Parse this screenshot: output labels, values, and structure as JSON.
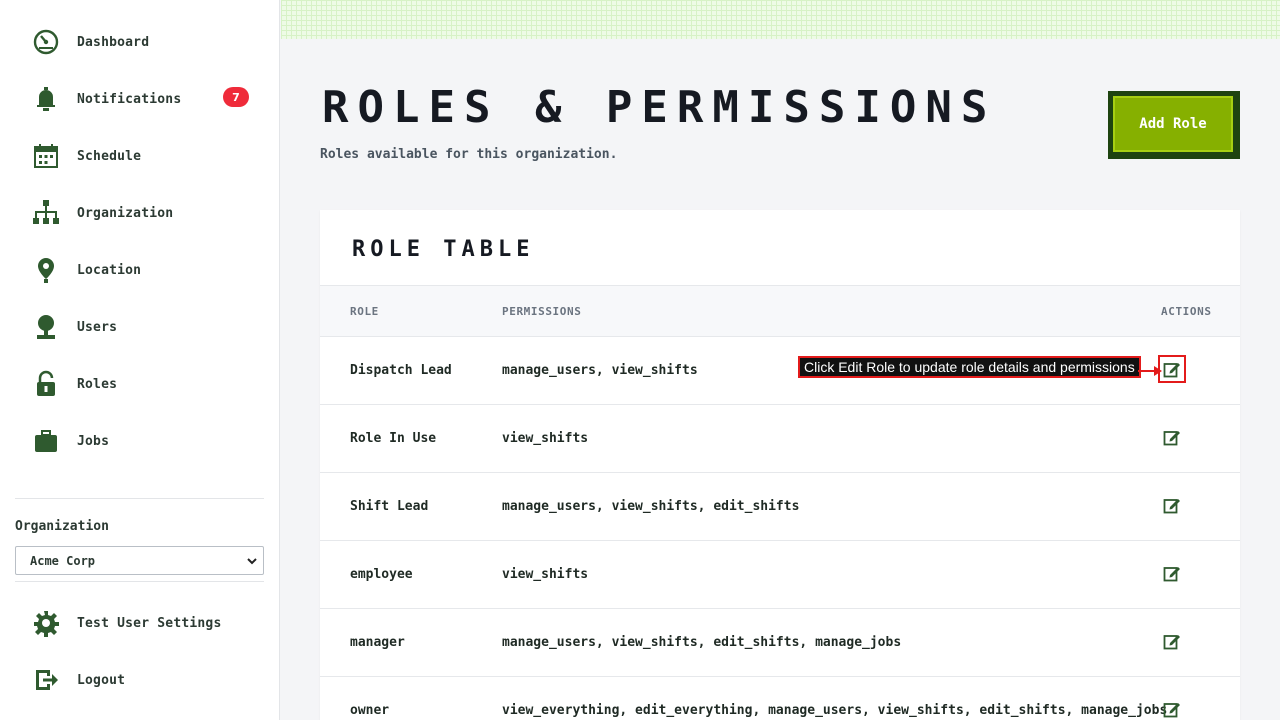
{
  "sidebar": {
    "items": [
      {
        "label": "Dashboard",
        "icon": "dashboard-gauge-icon"
      },
      {
        "label": "Notifications",
        "icon": "bell-icon",
        "badge": "7"
      },
      {
        "label": "Schedule",
        "icon": "calendar-icon"
      },
      {
        "label": "Organization",
        "icon": "org-chart-icon"
      },
      {
        "label": "Location",
        "icon": "map-pin-icon"
      },
      {
        "label": "Users",
        "icon": "user-icon"
      },
      {
        "label": "Roles",
        "icon": "lock-icon"
      },
      {
        "label": "Jobs",
        "icon": "briefcase-icon"
      }
    ],
    "organization_label": "Organization",
    "organization_selected": "Acme Corp",
    "footer_items": [
      {
        "label": "Test User Settings",
        "icon": "gear-icon"
      },
      {
        "label": "Logout",
        "icon": "logout-icon"
      }
    ]
  },
  "header": {
    "title": "Roles & Permissions",
    "subtitle": "Roles available for this organization.",
    "add_role_label": "Add Role"
  },
  "table": {
    "title": "Role Table",
    "columns": {
      "role": "ROLE",
      "permissions": "PERMISSIONS",
      "actions": "ACTIONS"
    },
    "rows": [
      {
        "role": "Dispatch Lead",
        "permissions": "manage_users, view_shifts"
      },
      {
        "role": "Role In Use",
        "permissions": "view_shifts"
      },
      {
        "role": "Shift Lead",
        "permissions": "manage_users, view_shifts, edit_shifts"
      },
      {
        "role": "employee",
        "permissions": "view_shifts"
      },
      {
        "role": "manager",
        "permissions": "manage_users, view_shifts, edit_shifts, manage_jobs"
      },
      {
        "role": "owner",
        "permissions": "view_everything, edit_everything, manage_users, view_shifts, edit_shifts, manage_jobs"
      }
    ]
  },
  "annotation": {
    "text": "Click Edit Role to update role details and permissions"
  },
  "colors": {
    "accent_green": "#86b000",
    "icon_green": "#2f5a2f",
    "badge_red": "#ef2b3a",
    "highlight_red": "#e31b1b"
  }
}
